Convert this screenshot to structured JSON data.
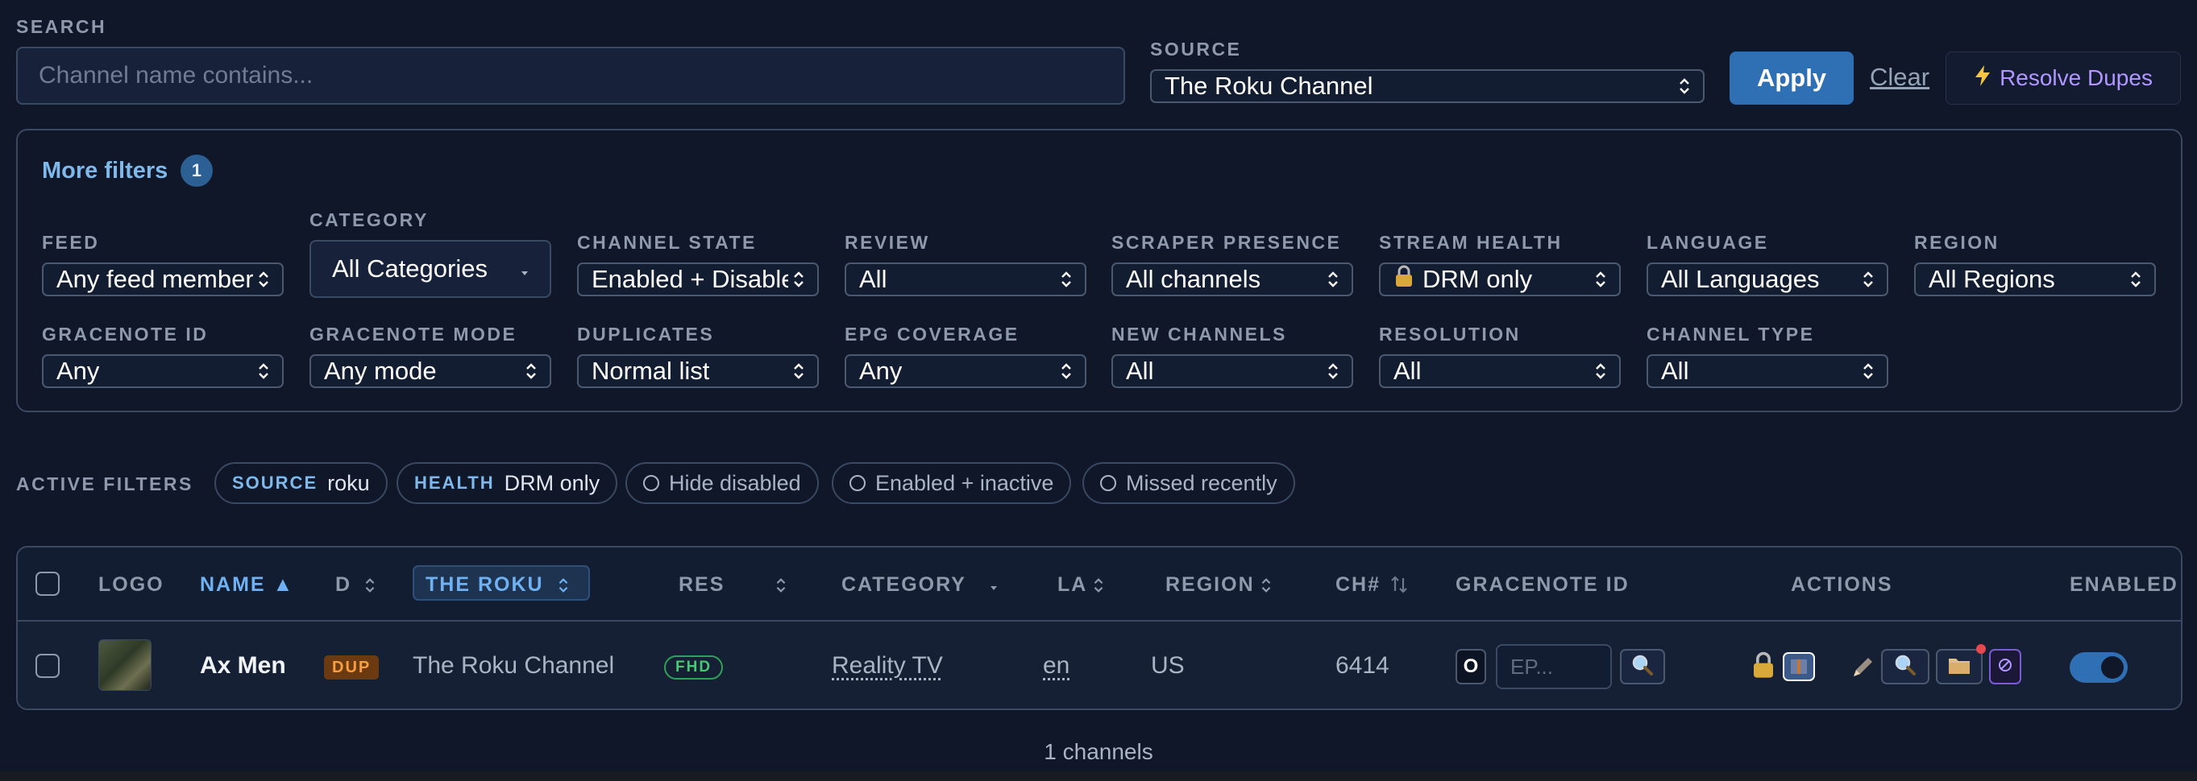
{
  "search": {
    "label": "SEARCH",
    "placeholder": "Channel name contains..."
  },
  "source": {
    "label": "SOURCE",
    "value": "The Roku Channel"
  },
  "buttons": {
    "apply": "Apply",
    "clear": "Clear",
    "resolve": "Resolve Dupes"
  },
  "more_filters": {
    "title": "More filters",
    "badge": "1",
    "feed": {
      "label": "FEED",
      "value": "Any feed member"
    },
    "category": {
      "label": "CATEGORY",
      "value": "All Categories"
    },
    "channel_state": {
      "label": "CHANNEL STATE",
      "value": "Enabled + Disabled"
    },
    "review": {
      "label": "REVIEW",
      "value": "All"
    },
    "scraper_presence": {
      "label": "SCRAPER PRESENCE",
      "value": "All channels"
    },
    "stream_health": {
      "label": "STREAM HEALTH",
      "value": "DRM only"
    },
    "language": {
      "label": "LANGUAGE",
      "value": "All Languages"
    },
    "region": {
      "label": "REGION",
      "value": "All Regions"
    },
    "gracenote_id": {
      "label": "GRACENOTE ID",
      "value": "Any"
    },
    "gracenote_mode": {
      "label": "GRACENOTE MODE",
      "value": "Any mode"
    },
    "duplicates": {
      "label": "DUPLICATES",
      "value": "Normal list"
    },
    "epg_coverage": {
      "label": "EPG COVERAGE",
      "value": "Any"
    },
    "new_channels": {
      "label": "NEW CHANNELS",
      "value": "All"
    },
    "resolution": {
      "label": "RESOLUTION",
      "value": "All"
    },
    "channel_type": {
      "label": "CHANNEL TYPE",
      "value": "All"
    }
  },
  "active_filters": {
    "label": "ACTIVE FILTERS",
    "source_key": "SOURCE",
    "source_val": "roku",
    "health_key": "HEALTH",
    "health_val": "DRM only",
    "hide_disabled": "Hide disabled",
    "enabled_inactive": "Enabled + inactive",
    "missed_recently": "Missed recently"
  },
  "table": {
    "headers": {
      "logo": "LOGO",
      "name": "NAME ▲",
      "d": "D",
      "source": "THE ROKU",
      "res": "RES",
      "category": "CATEGORY",
      "lang": "LA",
      "region": "REGION",
      "ch": "CH#",
      "gracenote": "GRACENOTE ID",
      "actions": "ACTIONS",
      "enabled": "ENABLED"
    },
    "row": {
      "name": "Ax Men",
      "dup": "DUP",
      "source": "The Roku Channel",
      "res": "FHD",
      "category": "Reality TV",
      "lang": "en",
      "region": "US",
      "ch": "6414",
      "o_btn": "O",
      "ep_placeholder": "EP..."
    }
  },
  "footer": {
    "count": "1 channels"
  },
  "colors": {
    "accent": "#2f6fb3",
    "link": "#7fb8ea",
    "purple": "#b197ff",
    "dup": "#f59e42",
    "fhd": "#48c774"
  }
}
